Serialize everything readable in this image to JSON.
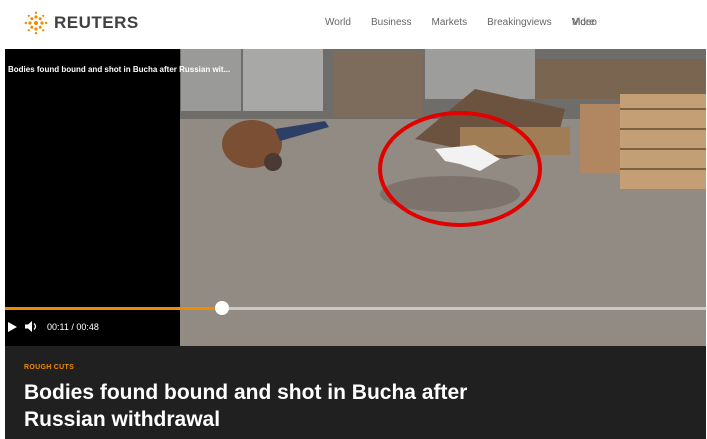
{
  "header": {
    "brand": "REUTERS",
    "nav": [
      "World",
      "Business",
      "Markets",
      "Breakingviews",
      "Video",
      "More"
    ]
  },
  "player": {
    "video_title": "Bodies found bound and shot in Bucha after Russian wit...",
    "time_display": "00:11 / 00:48",
    "progress": 0.31,
    "icons": [
      "play-icon",
      "volume-icon"
    ]
  },
  "article": {
    "kicker": "ROUGH CUTS",
    "headline": "Bodies found bound and shot in Bucha after Russian withdrawal"
  },
  "colors": {
    "accent": "#f08a00",
    "caption_bg": "#202020",
    "annotation": "#e00000"
  }
}
